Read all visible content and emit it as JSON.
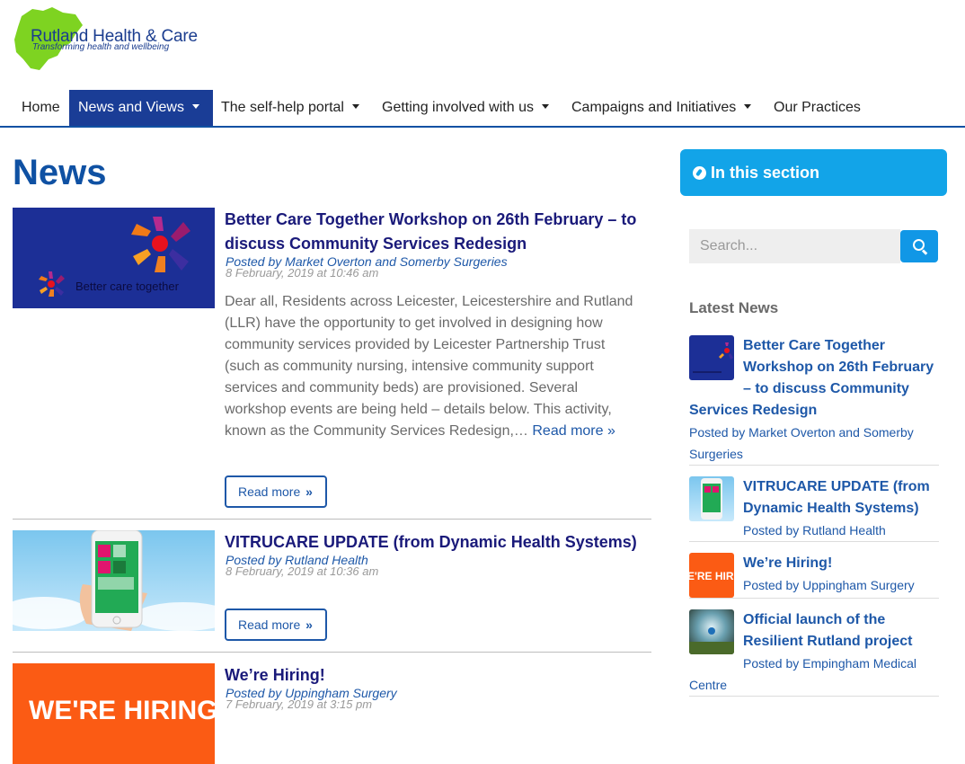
{
  "header": {
    "logo_name": "Rutland Health & Care",
    "logo_tagline": "Transforming health and wellbeing"
  },
  "nav": {
    "items": [
      {
        "label": "Home",
        "dropdown": false
      },
      {
        "label": "News and Views",
        "dropdown": true,
        "active": true
      },
      {
        "label": "The self-help portal",
        "dropdown": true
      },
      {
        "label": "Getting involved with us",
        "dropdown": true
      },
      {
        "label": "Campaigns and Initiatives",
        "dropdown": true
      },
      {
        "label": "Our Practices",
        "dropdown": false
      }
    ]
  },
  "main": {
    "title": "News",
    "read_more_button": "Read more",
    "posts": [
      {
        "title": "Better Care Together Workshop on 26th February – to discuss Community Services Redesign",
        "author": "Posted by Market Overton and Somerby Surgeries",
        "date": "8 February, 2019 at 10:46 am",
        "excerpt": "Dear all, Residents across Leicester, Leicestershire and Rutland (LLR) have the opportunity to get involved in designing how community services provided by Leicester Partnership Trust (such as community nursing, intensive community support services and community beds) are provisioned. Several workshop events are being held – details below. This activity, known as the Community Services Redesign,…",
        "excerpt_link": "Read more »",
        "image_text": "Better care together"
      },
      {
        "title": "VITRUCARE UPDATE (from Dynamic Health Systems)",
        "author": "Posted by Rutland Health",
        "date": "8 February, 2019 at 10:36 am"
      },
      {
        "title": "We’re Hiring!",
        "author": "Posted by Uppingham Surgery",
        "date": "7 February, 2019 at 3:15 pm",
        "image_text": "WE'RE HIRING!"
      }
    ]
  },
  "sidebar": {
    "section_label": "In this section",
    "search_placeholder": "Search...",
    "latest_heading": "Latest News",
    "latest": [
      {
        "title": "Better Care Together Workshop on 26th February – to discuss Community Services Redesign",
        "author": "Posted by Market Overton and Somerby Surgeries"
      },
      {
        "title": "VITRUCARE UPDATE (from Dynamic Health Systems)",
        "author": "Posted by Rutland Health"
      },
      {
        "title": "We’re Hiring!",
        "author": "Posted by Uppingham Surgery",
        "thumb_text": "E'RE HIRIN"
      },
      {
        "title": "Official launch of the Resilient Rutland project",
        "author": "Posted by Empingham Medical Centre"
      }
    ]
  },
  "colors": {
    "brand_blue": "#0f51a3",
    "nav_active": "#1a3d96",
    "accent_cyan": "#12a4e8",
    "link_blue": "#1e58a8",
    "logo_green": "#7ed321"
  }
}
